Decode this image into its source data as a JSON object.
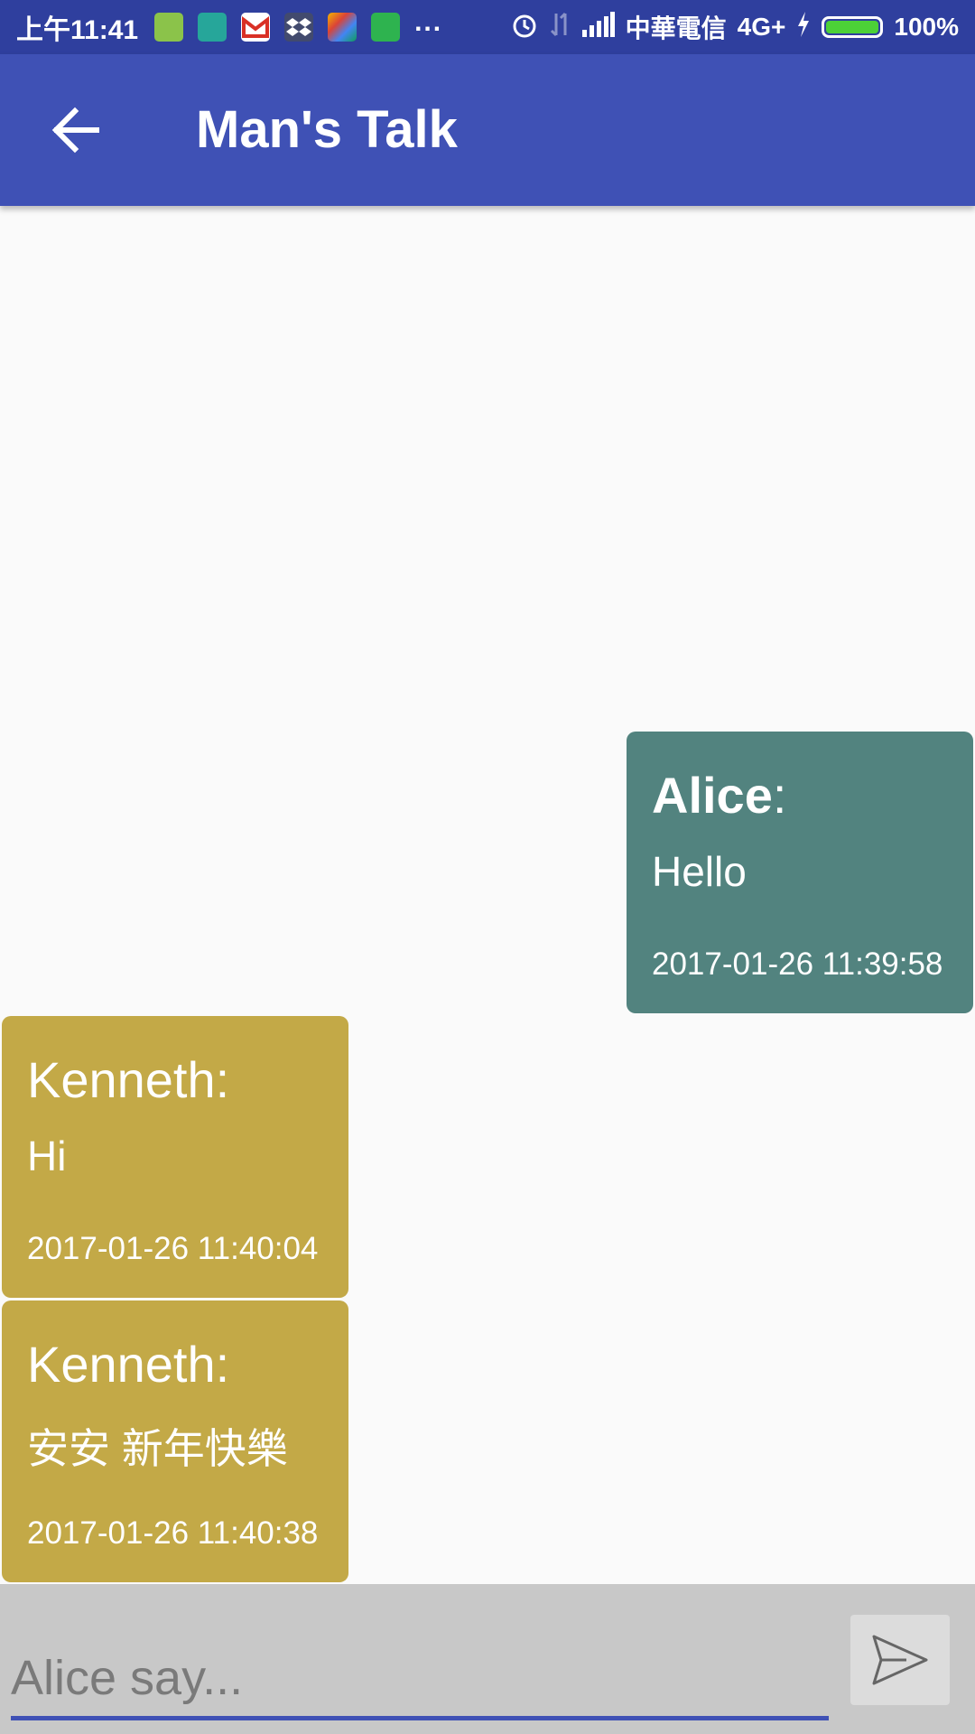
{
  "status_bar": {
    "time": "上午11:41",
    "carrier": "中華電信",
    "network": "4G+",
    "battery": "100%",
    "battery_level": 1.0,
    "more": "..."
  },
  "app_bar": {
    "title": "Man's Talk",
    "back_icon": "arrow-back-icon"
  },
  "messages": [
    {
      "side": "right",
      "sender": "Alice",
      "separator": ":",
      "text": "Hello",
      "time": "2017-01-26 11:39:58",
      "color": "#52837f"
    },
    {
      "side": "left",
      "sender": "Kenneth",
      "separator": ":",
      "text": "Hi",
      "time": "2017-01-26 11:40:04",
      "color": "#c3a947"
    },
    {
      "side": "left",
      "sender": "Kenneth",
      "separator": ":",
      "text": "安安 新年快樂",
      "time": "2017-01-26 11:40:38",
      "color": "#c3a947"
    }
  ],
  "composer": {
    "placeholder": "Alice say...",
    "send_icon": "send-icon"
  },
  "colors": {
    "primary": "#3f51b5",
    "primary_dark": "#2f3f9e",
    "alice_bubble": "#52837f",
    "kenneth_bubble": "#c3a947"
  }
}
